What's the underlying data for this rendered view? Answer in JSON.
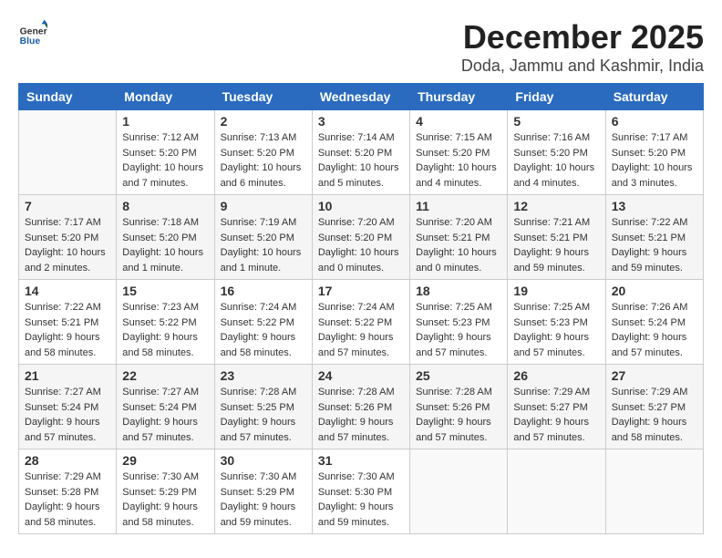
{
  "header": {
    "logo_general": "General",
    "logo_blue": "Blue",
    "month": "December 2025",
    "location": "Doda, Jammu and Kashmir, India"
  },
  "weekdays": [
    "Sunday",
    "Monday",
    "Tuesday",
    "Wednesday",
    "Thursday",
    "Friday",
    "Saturday"
  ],
  "weeks": [
    [
      {
        "day": "",
        "info": ""
      },
      {
        "day": "1",
        "info": "Sunrise: 7:12 AM\nSunset: 5:20 PM\nDaylight: 10 hours\nand 7 minutes."
      },
      {
        "day": "2",
        "info": "Sunrise: 7:13 AM\nSunset: 5:20 PM\nDaylight: 10 hours\nand 6 minutes."
      },
      {
        "day": "3",
        "info": "Sunrise: 7:14 AM\nSunset: 5:20 PM\nDaylight: 10 hours\nand 5 minutes."
      },
      {
        "day": "4",
        "info": "Sunrise: 7:15 AM\nSunset: 5:20 PM\nDaylight: 10 hours\nand 4 minutes."
      },
      {
        "day": "5",
        "info": "Sunrise: 7:16 AM\nSunset: 5:20 PM\nDaylight: 10 hours\nand 4 minutes."
      },
      {
        "day": "6",
        "info": "Sunrise: 7:17 AM\nSunset: 5:20 PM\nDaylight: 10 hours\nand 3 minutes."
      }
    ],
    [
      {
        "day": "7",
        "info": "Sunrise: 7:17 AM\nSunset: 5:20 PM\nDaylight: 10 hours\nand 2 minutes."
      },
      {
        "day": "8",
        "info": "Sunrise: 7:18 AM\nSunset: 5:20 PM\nDaylight: 10 hours\nand 1 minute."
      },
      {
        "day": "9",
        "info": "Sunrise: 7:19 AM\nSunset: 5:20 PM\nDaylight: 10 hours\nand 1 minute."
      },
      {
        "day": "10",
        "info": "Sunrise: 7:20 AM\nSunset: 5:20 PM\nDaylight: 10 hours\nand 0 minutes."
      },
      {
        "day": "11",
        "info": "Sunrise: 7:20 AM\nSunset: 5:21 PM\nDaylight: 10 hours\nand 0 minutes."
      },
      {
        "day": "12",
        "info": "Sunrise: 7:21 AM\nSunset: 5:21 PM\nDaylight: 9 hours\nand 59 minutes."
      },
      {
        "day": "13",
        "info": "Sunrise: 7:22 AM\nSunset: 5:21 PM\nDaylight: 9 hours\nand 59 minutes."
      }
    ],
    [
      {
        "day": "14",
        "info": "Sunrise: 7:22 AM\nSunset: 5:21 PM\nDaylight: 9 hours\nand 58 minutes."
      },
      {
        "day": "15",
        "info": "Sunrise: 7:23 AM\nSunset: 5:22 PM\nDaylight: 9 hours\nand 58 minutes."
      },
      {
        "day": "16",
        "info": "Sunrise: 7:24 AM\nSunset: 5:22 PM\nDaylight: 9 hours\nand 58 minutes."
      },
      {
        "day": "17",
        "info": "Sunrise: 7:24 AM\nSunset: 5:22 PM\nDaylight: 9 hours\nand 57 minutes."
      },
      {
        "day": "18",
        "info": "Sunrise: 7:25 AM\nSunset: 5:23 PM\nDaylight: 9 hours\nand 57 minutes."
      },
      {
        "day": "19",
        "info": "Sunrise: 7:25 AM\nSunset: 5:23 PM\nDaylight: 9 hours\nand 57 minutes."
      },
      {
        "day": "20",
        "info": "Sunrise: 7:26 AM\nSunset: 5:24 PM\nDaylight: 9 hours\nand 57 minutes."
      }
    ],
    [
      {
        "day": "21",
        "info": "Sunrise: 7:27 AM\nSunset: 5:24 PM\nDaylight: 9 hours\nand 57 minutes."
      },
      {
        "day": "22",
        "info": "Sunrise: 7:27 AM\nSunset: 5:24 PM\nDaylight: 9 hours\nand 57 minutes."
      },
      {
        "day": "23",
        "info": "Sunrise: 7:28 AM\nSunset: 5:25 PM\nDaylight: 9 hours\nand 57 minutes."
      },
      {
        "day": "24",
        "info": "Sunrise: 7:28 AM\nSunset: 5:26 PM\nDaylight: 9 hours\nand 57 minutes."
      },
      {
        "day": "25",
        "info": "Sunrise: 7:28 AM\nSunset: 5:26 PM\nDaylight: 9 hours\nand 57 minutes."
      },
      {
        "day": "26",
        "info": "Sunrise: 7:29 AM\nSunset: 5:27 PM\nDaylight: 9 hours\nand 57 minutes."
      },
      {
        "day": "27",
        "info": "Sunrise: 7:29 AM\nSunset: 5:27 PM\nDaylight: 9 hours\nand 58 minutes."
      }
    ],
    [
      {
        "day": "28",
        "info": "Sunrise: 7:29 AM\nSunset: 5:28 PM\nDaylight: 9 hours\nand 58 minutes."
      },
      {
        "day": "29",
        "info": "Sunrise: 7:30 AM\nSunset: 5:29 PM\nDaylight: 9 hours\nand 58 minutes."
      },
      {
        "day": "30",
        "info": "Sunrise: 7:30 AM\nSunset: 5:29 PM\nDaylight: 9 hours\nand 59 minutes."
      },
      {
        "day": "31",
        "info": "Sunrise: 7:30 AM\nSunset: 5:30 PM\nDaylight: 9 hours\nand 59 minutes."
      },
      {
        "day": "",
        "info": ""
      },
      {
        "day": "",
        "info": ""
      },
      {
        "day": "",
        "info": ""
      }
    ]
  ]
}
